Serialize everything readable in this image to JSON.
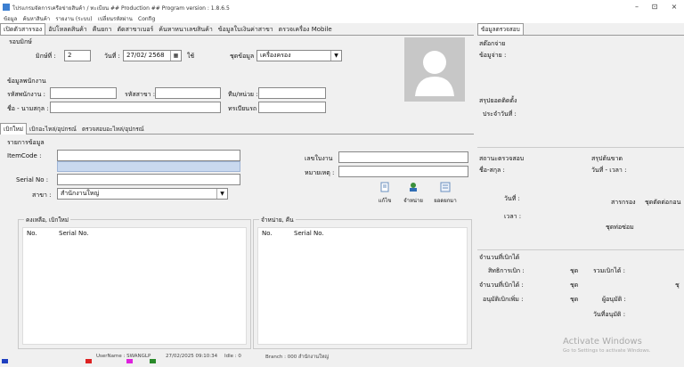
{
  "window": {
    "title": "โปรแกรมจัดการเครือข่ายสินค้า / ทะเบียน ## Production ## Program version : 1.8.6.5",
    "minimize": "–",
    "maximize": "⊡",
    "close": "×"
  },
  "menu": [
    "ข้อมูล",
    "ค้นหาสินค้า",
    "รายงาน (ระบบ)",
    "เปลี่ยนรหัสผ่าน",
    "Config"
  ],
  "tabs": [
    "เปิดตัวสารรอง",
    "อัปโหลดสินค้า",
    "คืนยกา",
    "ตัดสาขาเบอร์",
    "ค้นหาหนาเลขสินค้า",
    "ข้อมูลใบเงินค่าสาขา",
    "ตรวจเครื่อง Mobile"
  ],
  "receive": {
    "section": "รอบมิกษ์",
    "round_label": "มิกษ์ที่ :",
    "round_value": "2",
    "date_label": "วันที่ :",
    "date_value": "27/02/ 2568",
    "date_btn": "ใช้",
    "category_label": "ชุดข้อมูล :",
    "category_value": "เครื่องครอง"
  },
  "employee": {
    "section": "ข้อมูลพนักงาน",
    "code_label": "รหัสพนักงาน :",
    "code_value": "",
    "branch_label": "รหัสสาขา :",
    "branch_value": "",
    "phone_label": "ทีม/หน่วย :",
    "phone_value": "",
    "name_label": "ชื่อ - นามสกุล :",
    "name_value": "",
    "tel_label": "ทรเบียนรถ :",
    "tel_value": ""
  },
  "subtabs": [
    "เบิกใหม่",
    "เบิกอะไหล่/อุปกรณ์",
    "ตรวจสอบอะไหล่/อุปกรณ์"
  ],
  "item": {
    "section": "รายการข้อมูล",
    "itemcode_label": "ItemCode :",
    "itemcode_value": "",
    "serial_label": "Serial No :",
    "serial_value": "",
    "branch_label": "สาขา :",
    "branch_value": "สำนักงานใหญ่",
    "docno_label": "เลขใบงาน",
    "docno_value": "",
    "remark_label": "หมายเหตุ :",
    "remark_value": "",
    "btn_edit": "แก้ไข",
    "btn_dispatch": "จำหน่าย",
    "btn_cancel": "ยอดยกมา"
  },
  "list_left": {
    "title": "คงเหลือ, เบิกใหม่",
    "col1": "No.",
    "col2": "Serial No."
  },
  "list_right": {
    "title": "จำหน่าย, คืน",
    "col1": "No.",
    "col2": "Serial No."
  },
  "right_panel": {
    "tab": "ข้อมูลตรวจสอบ",
    "sec1_title": "สต๊อกจ่าย",
    "sec1_line": "ข้อมูจ่าย :",
    "sec2_title": "สรุปยอดติดตั้ง",
    "sec2_line": "ประจำวันที่ :",
    "sec3_title": "สถานะตรวจสอบ",
    "sec3_name": "ชื่อ-สกุล :",
    "sec3_date": "วันที่ :",
    "sec3_time": "เวลา :",
    "sec4_title": "สรุปต้นขาด",
    "sec4_datetime": "วันที่ - เวลา :",
    "sec4_a": "สารกรอง",
    "sec4_b": "ชุดตัดต่อกอน",
    "sec4_c": "ชุดท่อซ่อม",
    "sec5_title": "จำนวนที่เบิกได้",
    "row1_label": "สิทธิการเบิก :",
    "row1_unit": "ชุด",
    "row1_right": "รวมเบิกได้ :",
    "row2_label": "จำนวนที่เบิกได้ :",
    "row2_unit": "ชุด",
    "row2_right": "ชุ",
    "row3_label": "อนุมัติเบิกเพิ่ม :",
    "row3_unit": "ชุด",
    "row3_right": "ผู้อนุมัติ :",
    "row4_right": "วันที่อนุมัติ :"
  },
  "watermark": {
    "line1": "Activate Windows",
    "line2": "Go to Settings to activate Windows."
  },
  "status": {
    "user": "UserName : SWANGLP",
    "datetime": "27/02/2025 09:10:34",
    "idle": "Idle : 0",
    "branch": "Branch : 000 สำนักงานใหญ่"
  },
  "colors": {
    "accent": "#3c7fd1",
    "bg": "#f0f0f0"
  }
}
